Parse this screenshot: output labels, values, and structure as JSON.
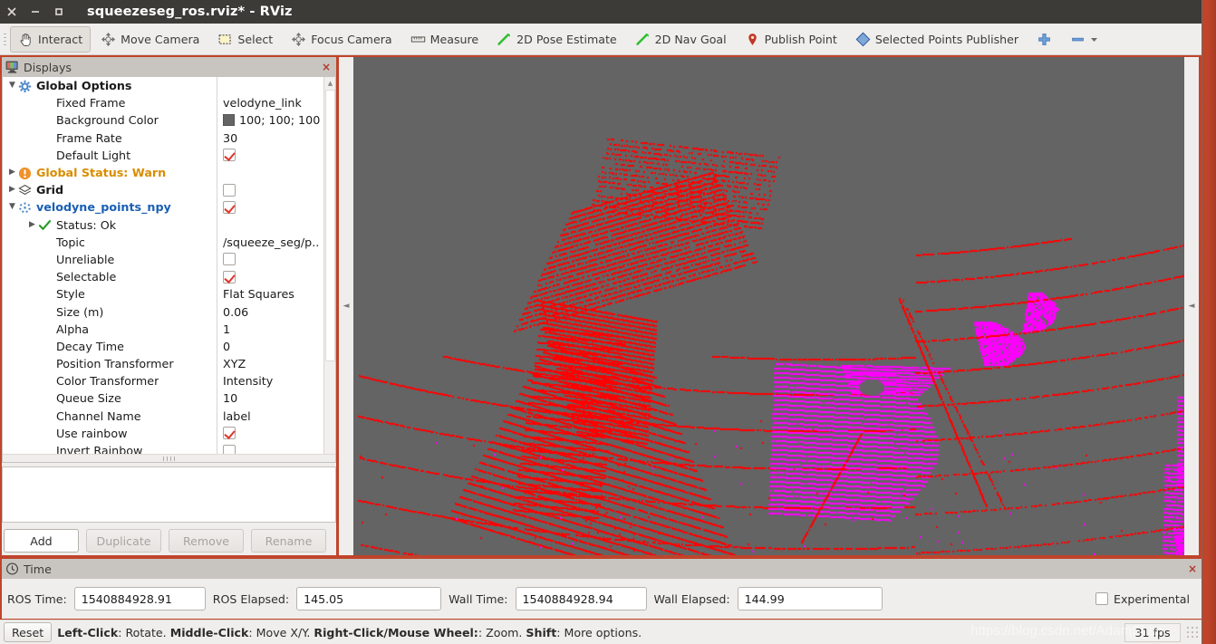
{
  "window": {
    "title": "squeezeseg_ros.rviz* - RViz",
    "buttons": {
      "close": "close-icon",
      "minimize": "minimize-icon",
      "maximize": "maximize-icon"
    }
  },
  "toolbar": {
    "items": [
      {
        "label": "Interact",
        "icon": "hand-cursor-icon",
        "active": true
      },
      {
        "label": "Move Camera",
        "icon": "move-camera-icon",
        "active": false
      },
      {
        "label": "Select",
        "icon": "select-rectangle-icon",
        "active": false
      },
      {
        "label": "Focus Camera",
        "icon": "focus-camera-icon",
        "active": false
      },
      {
        "label": "Measure",
        "icon": "ruler-icon",
        "active": false
      },
      {
        "label": "2D Pose Estimate",
        "icon": "green-arrow-icon",
        "active": false
      },
      {
        "label": "2D Nav Goal",
        "icon": "green-arrow-icon",
        "active": false
      },
      {
        "label": "Publish Point",
        "icon": "map-pin-icon",
        "active": false
      },
      {
        "label": "Selected Points Publisher",
        "icon": "blue-diamond-icon",
        "active": false
      }
    ],
    "add_tool_label": "+",
    "remove_tool_label": "−"
  },
  "displays": {
    "panel_title": "Displays",
    "close_label": "×",
    "rows": [
      {
        "name": "Global Options",
        "indent": 0,
        "arrow": "down",
        "icon": "gear-icon",
        "style": "bold",
        "value_type": "none"
      },
      {
        "name": "Fixed Frame",
        "indent": 1,
        "arrow": "none",
        "icon": "none",
        "style": "plain",
        "value_type": "text",
        "value": "velodyne_link"
      },
      {
        "name": "Background Color",
        "indent": 1,
        "arrow": "none",
        "icon": "none",
        "style": "plain",
        "value_type": "color",
        "value": "100; 100; 100",
        "swatch": "#646464"
      },
      {
        "name": "Frame Rate",
        "indent": 1,
        "arrow": "none",
        "icon": "none",
        "style": "plain",
        "value_type": "text",
        "value": "30"
      },
      {
        "name": "Default Light",
        "indent": 1,
        "arrow": "none",
        "icon": "none",
        "style": "plain",
        "value_type": "checkbox",
        "checked": true
      },
      {
        "name": "Global Status: Warn",
        "indent": 0,
        "arrow": "right",
        "icon": "warn-icon",
        "style": "warn",
        "value_type": "none"
      },
      {
        "name": "Grid",
        "indent": 0,
        "arrow": "right",
        "icon": "grid-icon",
        "style": "bold",
        "value_type": "checkbox",
        "checked": false
      },
      {
        "name": "velodyne_points_npy",
        "indent": 0,
        "arrow": "down",
        "icon": "pointcloud-icon",
        "style": "topic",
        "value_type": "checkbox",
        "checked": true
      },
      {
        "name": "Status: Ok",
        "indent": 1,
        "arrow": "right",
        "icon": "check-icon",
        "style": "plain",
        "value_type": "none"
      },
      {
        "name": "Topic",
        "indent": 1,
        "arrow": "none",
        "icon": "none",
        "style": "plain",
        "value_type": "text",
        "value": "/squeeze_seg/p.."
      },
      {
        "name": "Unreliable",
        "indent": 1,
        "arrow": "none",
        "icon": "none",
        "style": "plain",
        "value_type": "checkbox",
        "checked": false
      },
      {
        "name": "Selectable",
        "indent": 1,
        "arrow": "none",
        "icon": "none",
        "style": "plain",
        "value_type": "checkbox",
        "checked": true
      },
      {
        "name": "Style",
        "indent": 1,
        "arrow": "none",
        "icon": "none",
        "style": "plain",
        "value_type": "text",
        "value": "Flat Squares"
      },
      {
        "name": "Size (m)",
        "indent": 1,
        "arrow": "none",
        "icon": "none",
        "style": "plain",
        "value_type": "text",
        "value": "0.06"
      },
      {
        "name": "Alpha",
        "indent": 1,
        "arrow": "none",
        "icon": "none",
        "style": "plain",
        "value_type": "text",
        "value": "1"
      },
      {
        "name": "Decay Time",
        "indent": 1,
        "arrow": "none",
        "icon": "none",
        "style": "plain",
        "value_type": "text",
        "value": "0"
      },
      {
        "name": "Position Transformer",
        "indent": 1,
        "arrow": "none",
        "icon": "none",
        "style": "plain",
        "value_type": "text",
        "value": "XYZ"
      },
      {
        "name": "Color Transformer",
        "indent": 1,
        "arrow": "none",
        "icon": "none",
        "style": "plain",
        "value_type": "text",
        "value": "Intensity"
      },
      {
        "name": "Queue Size",
        "indent": 1,
        "arrow": "none",
        "icon": "none",
        "style": "plain",
        "value_type": "text",
        "value": "10"
      },
      {
        "name": "Channel Name",
        "indent": 1,
        "arrow": "none",
        "icon": "none",
        "style": "plain",
        "value_type": "text",
        "value": "label"
      },
      {
        "name": "Use rainbow",
        "indent": 1,
        "arrow": "none",
        "icon": "none",
        "style": "plain",
        "value_type": "checkbox",
        "checked": true
      },
      {
        "name": "Invert Rainbow",
        "indent": 1,
        "arrow": "none",
        "icon": "none",
        "style": "plain",
        "value_type": "checkbox",
        "checked": false
      }
    ],
    "buttons": [
      {
        "label": "Add",
        "enabled": true
      },
      {
        "label": "Duplicate",
        "enabled": false
      },
      {
        "label": "Remove",
        "enabled": false
      },
      {
        "label": "Rename",
        "enabled": false
      }
    ]
  },
  "view": {
    "background_color": "#646464",
    "collapse_left": "◄",
    "collapse_right": "◄",
    "point_colors": {
      "ground": "#ff0000",
      "object": "#ff00ff"
    }
  },
  "time": {
    "panel_title": "Time",
    "close_label": "×",
    "fields": [
      {
        "label": "ROS Time:",
        "value": "1540884928.91"
      },
      {
        "label": "ROS Elapsed:",
        "value": "145.05"
      },
      {
        "label": "Wall Time:",
        "value": "1540884928.94"
      },
      {
        "label": "Wall Elapsed:",
        "value": "144.99"
      }
    ],
    "experimental_label": "Experimental",
    "experimental_checked": false
  },
  "statusbar": {
    "reset_label": "Reset",
    "hint_parts": [
      {
        "text": "Left-Click",
        "bold": true
      },
      {
        "text": ": Rotate. ",
        "bold": false
      },
      {
        "text": "Middle-Click",
        "bold": true
      },
      {
        "text": ": Move X/Y. ",
        "bold": false
      },
      {
        "text": "Right-Click/Mouse Wheel:",
        "bold": true
      },
      {
        "text": ": Zoom. ",
        "bold": false
      },
      {
        "text": "Shift",
        "bold": true
      },
      {
        "text": ": More options.",
        "bold": false
      }
    ],
    "fps": "31 fps",
    "watermark": "https://blog.csdn.net/AdamShan"
  }
}
